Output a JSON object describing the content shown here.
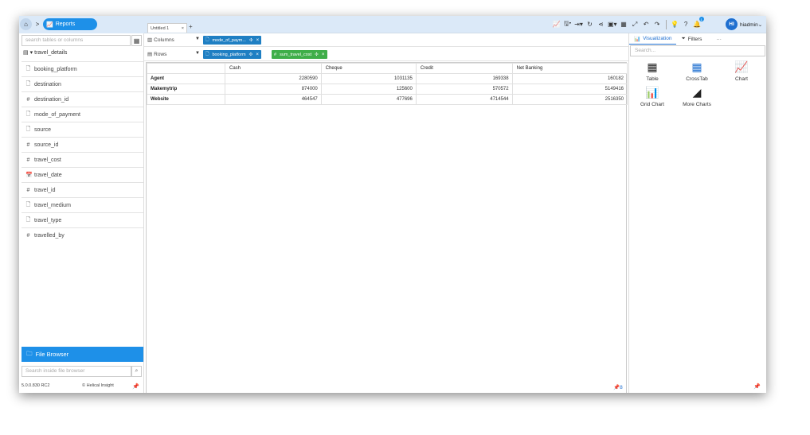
{
  "breadcrumb": {
    "home_icon": "home-icon",
    "separator": ">",
    "current": "Reports"
  },
  "left": {
    "search_placeholder": "search tables or columns",
    "table_name": "travel_details",
    "fields": [
      {
        "type": "text",
        "name": "booking_platform"
      },
      {
        "type": "text",
        "name": "destination"
      },
      {
        "type": "number",
        "name": "destination_id"
      },
      {
        "type": "text",
        "name": "mode_of_payment"
      },
      {
        "type": "text",
        "name": "source"
      },
      {
        "type": "number",
        "name": "source_id"
      },
      {
        "type": "number",
        "name": "travel_cost"
      },
      {
        "type": "date",
        "name": "travel_date"
      },
      {
        "type": "number",
        "name": "travel_id"
      },
      {
        "type": "text",
        "name": "travel_medium"
      },
      {
        "type": "text",
        "name": "travel_type"
      },
      {
        "type": "number",
        "name": "travelled_by"
      }
    ],
    "file_browser_label": "File Browser",
    "file_search_placeholder": "Search inside file browser",
    "version": "5.0.0.830 RC2",
    "brand": "Helical Insight"
  },
  "topbar": {
    "tab_label": "Untitled 1",
    "tab_close": "×",
    "tab_add": "+",
    "notification_count": "1",
    "avatar_initials": "HI",
    "username": "hiadmin"
  },
  "shelves": {
    "columns_label": "Columns",
    "rows_label": "Rows",
    "columns_chips": [
      {
        "label": "mode_of_paym...",
        "kind": "text"
      }
    ],
    "rows_chips": [
      {
        "label": "booking_platform",
        "kind": "text"
      },
      {
        "label": "sum_travel_cost",
        "kind": "number"
      }
    ]
  },
  "grid": {
    "columns": [
      "",
      "Cash",
      "Cheque",
      "Credit",
      "Net Banking"
    ],
    "rows": [
      {
        "label": "Agent",
        "values": [
          "2280590",
          "1031135",
          "169338",
          "160182"
        ]
      },
      {
        "label": "Makemytrip",
        "values": [
          "874000",
          "125600",
          "570572",
          "5149416"
        ]
      },
      {
        "label": "Website",
        "values": [
          "464547",
          "477696",
          "4714544",
          "2516350"
        ]
      }
    ]
  },
  "right": {
    "tab_visualization": "Visualization",
    "tab_filters": "Filters",
    "tab_more": "···",
    "search_placeholder": "Search...",
    "viz_types": [
      {
        "label": "Table",
        "icon": "table-icon"
      },
      {
        "label": "CrossTab",
        "icon": "crosstab-icon"
      },
      {
        "label": "Chart",
        "icon": "line-chart-icon"
      },
      {
        "label": "Grid Chart",
        "icon": "grid-chart-icon"
      },
      {
        "label": "More Charts",
        "icon": "area-chart-icon"
      }
    ]
  },
  "colors": {
    "accent": "#1e90e8",
    "chip_blue": "#1f7fc3",
    "chip_green": "#3fae49",
    "header_bg": "#dbe9f8"
  }
}
